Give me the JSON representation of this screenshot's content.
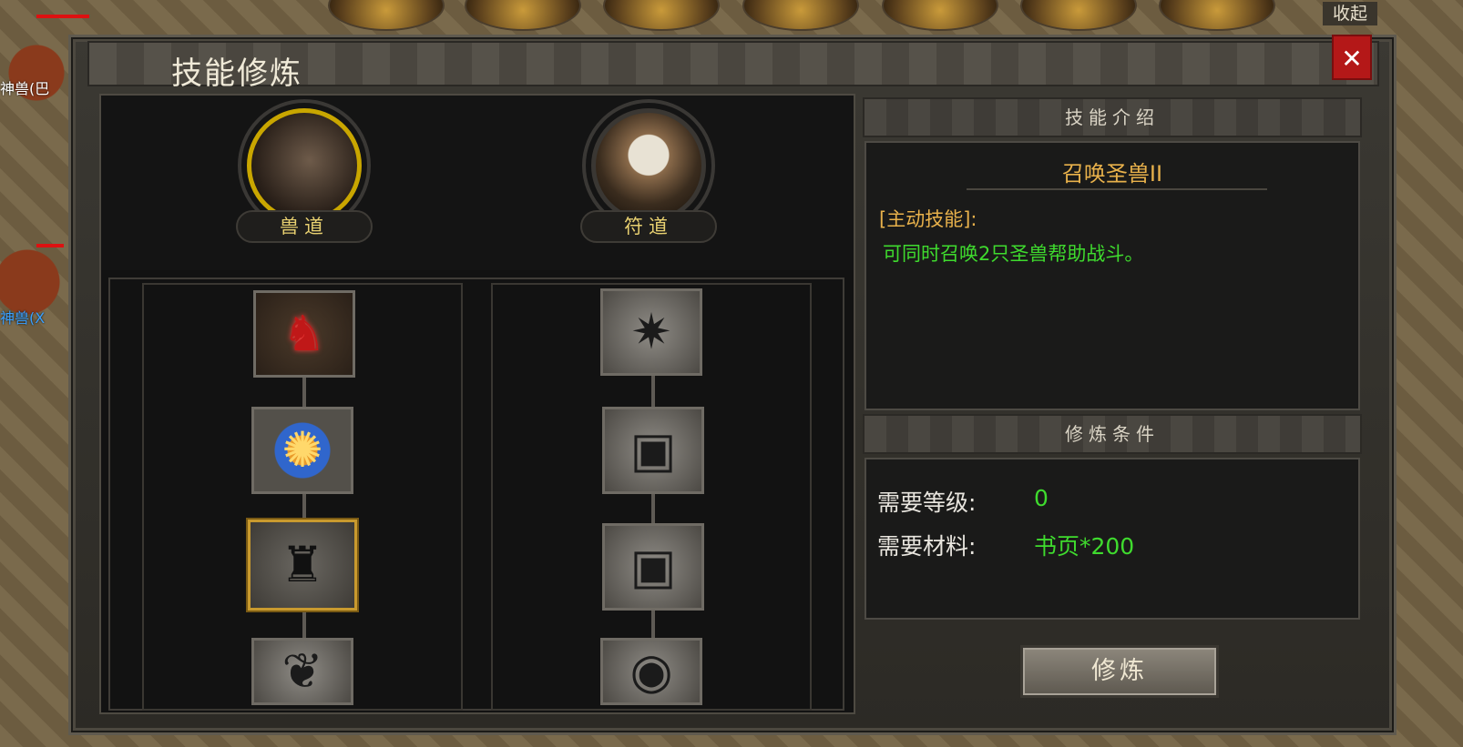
{
  "world": {
    "npc_labels": [
      "神兽(巴",
      "神兽(X"
    ]
  },
  "topbar": {
    "collapse_label": "收起"
  },
  "window": {
    "title": "技能修炼",
    "close_glyph": "✕"
  },
  "paths": [
    {
      "label": "兽道",
      "portrait_icon": "beast-warrior-portrait",
      "selected": true
    },
    {
      "label": "符道",
      "portrait_icon": "white-haired-mage-portrait",
      "selected": false
    }
  ],
  "skill_trees": {
    "beast": [
      {
        "icon": "red-demon-icon",
        "glyph": "♞"
      },
      {
        "icon": "fire-orb-icon",
        "glyph": "✺"
      },
      {
        "icon": "horned-helm-icon",
        "glyph": "♜",
        "selected": true
      },
      {
        "icon": "tentacle-beast-icon",
        "glyph": "❦"
      }
    ],
    "talisman": [
      {
        "icon": "light-burst-icon",
        "glyph": "✷"
      },
      {
        "icon": "talisman-seal-icon",
        "glyph": "▣"
      },
      {
        "icon": "talisman-seal-icon",
        "glyph": "▣"
      },
      {
        "icon": "flame-droplet-icon",
        "glyph": "◉"
      }
    ]
  },
  "skill_intro": {
    "header": "技能介绍",
    "name": "召唤圣兽II",
    "type": "[主动技能]:",
    "description": "可同时召唤2只圣兽帮助战斗。"
  },
  "requirements": {
    "header": "修炼条件",
    "level_label": "需要等级:",
    "level_value": "0",
    "material_label": "需要材料:",
    "material_value": "书页*200"
  },
  "actions": {
    "train_label": "修炼"
  },
  "colors": {
    "gold_text": "#e8b14b",
    "green_text": "#3fdb2e",
    "selected_border": "#c99a2e"
  }
}
